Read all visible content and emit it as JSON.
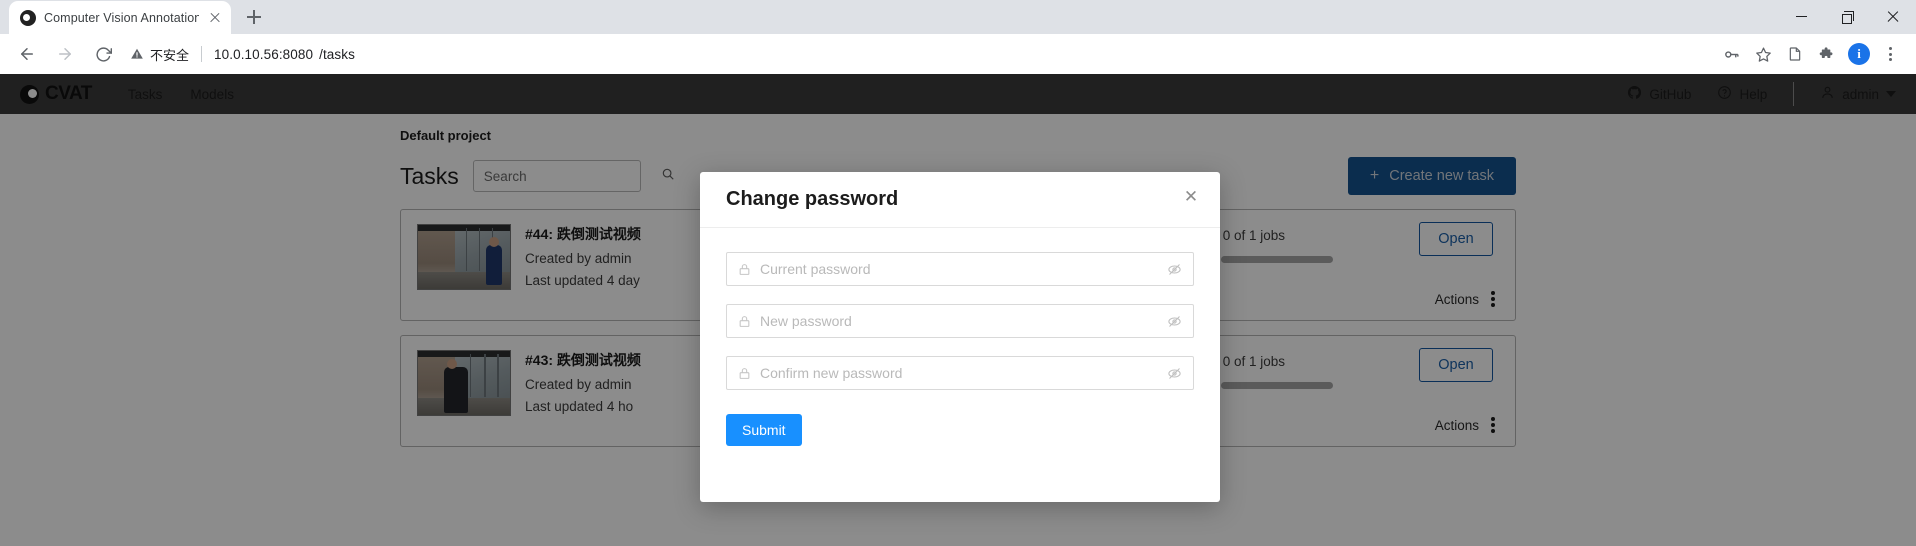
{
  "browser": {
    "tab": {
      "title": "Computer Vision Annotation T",
      "favicon": "cvat-favicon",
      "close_icon": "close-icon"
    },
    "new_tab_icon": "plus-icon",
    "window_controls": {
      "minimize": "minimize-icon",
      "maximize": "maximize-icon",
      "close": "close-icon"
    },
    "nav": {
      "back_icon": "back-arrow-icon",
      "forward_icon": "forward-arrow-icon",
      "reload_icon": "reload-icon"
    },
    "omnibox": {
      "security_icon": "warning-triangle-icon",
      "security_label": "不安全",
      "url_host": "10.0.10.56:8080",
      "url_path": "/tasks"
    },
    "toolbar_icons": [
      "key-icon",
      "star-icon",
      "reading-list-icon",
      "extensions-puzzle-icon"
    ],
    "profile_avatar": "i",
    "menu_icon": "kebab-menu-icon"
  },
  "cvat": {
    "logo_text": "CVAT",
    "nav": [
      {
        "label": "Tasks"
      },
      {
        "label": "Models"
      }
    ],
    "right": {
      "github_label": "GitHub",
      "github_icon": "github-icon",
      "help_label": "Help",
      "help_icon": "question-circle-icon",
      "user_label": "admin",
      "user_icon": "user-icon",
      "caret_icon": "chevron-down-icon"
    },
    "project_label": "Default project",
    "tasks_title": "Tasks",
    "search": {
      "value": "",
      "placeholder": "Search",
      "icon": "search-icon"
    },
    "create_button": {
      "label": "Create new task",
      "icon": "plus-icon"
    },
    "tasks": [
      {
        "id": "#44:",
        "name": "跌倒测试视频",
        "created_by": "Created by admin",
        "last_updated": "Last updated 4 day",
        "jobs": "0 of 1 jobs",
        "open_label": "Open",
        "actions_label": "Actions",
        "actions_icon": "vertical-dots-icon",
        "thumbnail": "corridor-person-blue-shirt"
      },
      {
        "id": "#43:",
        "name": "跌倒测试视频",
        "created_by": "Created by admin",
        "last_updated": "Last updated 4 ho",
        "jobs": "0 of 1 jobs",
        "open_label": "Open",
        "actions_label": "Actions",
        "actions_icon": "vertical-dots-icon",
        "thumbnail": "corridor-person-dark-jacket"
      }
    ]
  },
  "modal": {
    "title": "Change password",
    "close_icon": "close-icon",
    "fields": [
      {
        "value": "",
        "placeholder": "Current password",
        "lock_icon": "lock-icon",
        "eye_icon": "eye-invisible-icon"
      },
      {
        "value": "",
        "placeholder": "New password",
        "lock_icon": "lock-icon",
        "eye_icon": "eye-invisible-icon"
      },
      {
        "value": "",
        "placeholder": "Confirm new password",
        "lock_icon": "lock-icon",
        "eye_icon": "eye-invisible-icon"
      }
    ],
    "submit_label": "Submit"
  },
  "colors": {
    "accent_blue": "#1890ff",
    "create_button_blue": "#14528f",
    "header_dark": "#3b3b3b",
    "chrome_tabstrip": "#dee1e6"
  }
}
